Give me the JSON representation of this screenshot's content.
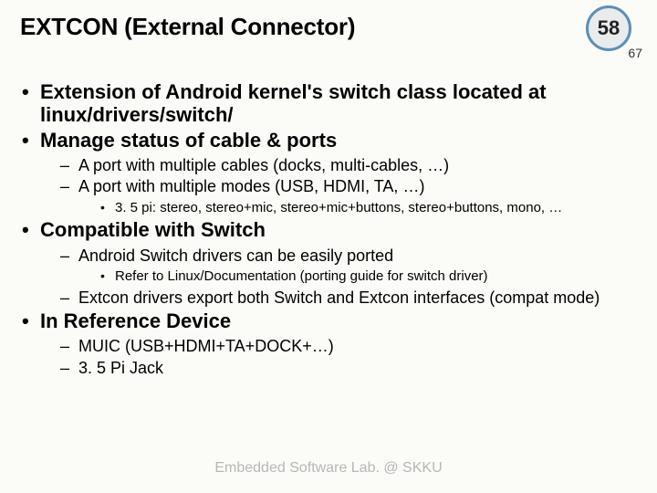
{
  "title": "EXTCON (External Connector)",
  "badge": {
    "main": "58",
    "sub": "67"
  },
  "bullets": [
    {
      "text": "Extension of Android kernel's switch class located at linux/drivers/switch/",
      "children": []
    },
    {
      "text": "Manage status of cable & ports",
      "children": [
        {
          "text": "A port with multiple cables (docks, multi-cables, …)",
          "children": []
        },
        {
          "text": "A port with multiple modes (USB, HDMI, TA, …)",
          "children": [
            {
              "text": "3. 5 pi: stereo, stereo+mic, stereo+mic+buttons, stereo+buttons, mono, …"
            }
          ]
        }
      ]
    },
    {
      "text": "Compatible with Switch",
      "children": [
        {
          "text": "Android Switch drivers can be easily ported",
          "children": [
            {
              "text": "Refer to Linux/Documentation (porting guide for switch driver)"
            }
          ]
        },
        {
          "text": "Extcon drivers export both Switch and Extcon interfaces (compat mode)",
          "children": []
        }
      ]
    },
    {
      "text": "In Reference Device",
      "children": [
        {
          "text": "MUIC (USB+HDMI+TA+DOCK+…)",
          "children": []
        },
        {
          "text": "3. 5 Pi Jack",
          "children": []
        }
      ]
    }
  ],
  "footer": "Embedded Software Lab. @ SKKU"
}
